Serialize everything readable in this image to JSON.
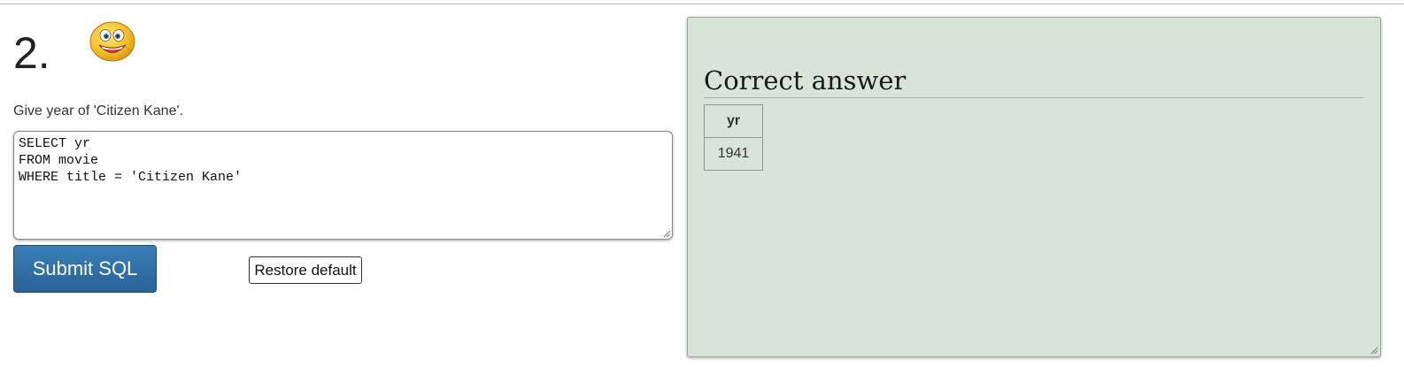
{
  "question": {
    "number": "2.",
    "text": "Give year of 'Citizen Kane'.",
    "status_icon": "smiley-face-icon"
  },
  "editor": {
    "sql": "SELECT yr\nFROM movie\nWHERE title = 'Citizen Kane'"
  },
  "buttons": {
    "submit_label": "Submit SQL",
    "restore_label": "Restore default"
  },
  "answer": {
    "heading": "Correct answer",
    "columns": [
      "yr"
    ],
    "rows": [
      [
        "1941"
      ]
    ]
  },
  "colors": {
    "panel_bg": "#d9e4d9",
    "submit_bg": "#2a6296"
  }
}
